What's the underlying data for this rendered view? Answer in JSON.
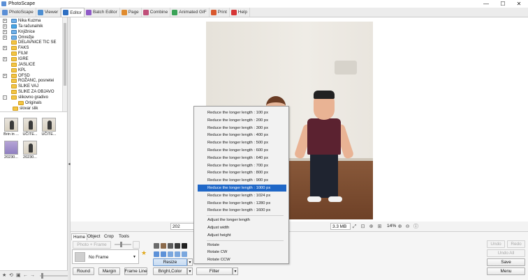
{
  "window": {
    "title": "PhotoScape",
    "minimize": "—",
    "maximize": "☐",
    "close": "✕"
  },
  "tabs": [
    {
      "label": "PhotoScape",
      "color": "#5b8fd6"
    },
    {
      "label": "Viewer",
      "color": "#4f8fd1"
    },
    {
      "label": "Editor",
      "color": "#2e6fc2"
    },
    {
      "label": "Batch Editor",
      "color": "#8f5ac7"
    },
    {
      "label": "Page",
      "color": "#e08b2e"
    },
    {
      "label": "Combine",
      "color": "#c04f79"
    },
    {
      "label": "Animated GIF",
      "color": "#3aa357"
    },
    {
      "label": "Print",
      "color": "#d9582d"
    },
    {
      "label": "Help",
      "color": "#d63535"
    }
  ],
  "folders": [
    {
      "label": "Nika Kuzma",
      "expander": "+",
      "kind": "user"
    },
    {
      "label": "Ta računalnik",
      "expander": "+",
      "kind": "blue"
    },
    {
      "label": "Knjižnice",
      "expander": "+",
      "kind": "special"
    },
    {
      "label": "Omrežje",
      "expander": "+",
      "kind": "special"
    },
    {
      "label": "DELAVNICE TIC SE",
      "expander": "",
      "kind": "folder"
    },
    {
      "label": "FAKS",
      "expander": "+",
      "kind": "folder"
    },
    {
      "label": "FILM",
      "expander": "",
      "kind": "folder"
    },
    {
      "label": "IGRE",
      "expander": "+",
      "kind": "folder"
    },
    {
      "label": "JASLICE",
      "expander": "",
      "kind": "folder"
    },
    {
      "label": "KPL",
      "expander": "",
      "kind": "folder"
    },
    {
      "label": "OFSD",
      "expander": "+",
      "kind": "folder"
    },
    {
      "label": "ROŽANC, posnetei",
      "expander": "",
      "kind": "folder"
    },
    {
      "label": "SLIKE VAJ",
      "expander": "",
      "kind": "folder"
    },
    {
      "label": "SLIKE ZA OBJAVO",
      "expander": "",
      "kind": "folder"
    },
    {
      "label": "slikovno gradivo",
      "expander": "-",
      "kind": "folder"
    },
    {
      "label": "Originals",
      "expander": "",
      "kind": "folder"
    },
    {
      "label": "slovar slik",
      "expander": "",
      "kind": "folder"
    }
  ],
  "thumbnails": [
    {
      "caption": "Brin in ...",
      "kind": "photo"
    },
    {
      "caption": "UČITE...",
      "kind": "photo"
    },
    {
      "caption": "UČITE...",
      "kind": "photo"
    },
    {
      "caption": "20230...",
      "kind": "purple"
    },
    {
      "caption": "20230...",
      "kind": "photo"
    }
  ],
  "left_toolbar_icons": [
    "★",
    "⟲",
    "▣",
    "←",
    "→"
  ],
  "status": {
    "date": "202",
    "filesize": "3.3 MB",
    "zoom": "14%"
  },
  "panel_tabs": [
    "Home",
    "Object",
    "Crop",
    "Tools"
  ],
  "panel": {
    "photo_frame": "Photo + Frame",
    "frame_value": "No Frame",
    "round": "Round",
    "margin": "Margin",
    "frame_line": "Frame Line",
    "resize": "Resize",
    "bright_color": "Bright,Color",
    "filter": "Filter",
    "undo": "Undo",
    "redo": "Redo",
    "undo_all": "Undo All",
    "save": "Save",
    "menu": "Menu",
    "arrow": "▼"
  },
  "resize_menu": {
    "items": [
      "Reduce the longer length : 100 px",
      "Reduce the longer length : 200 px",
      "Reduce the longer length : 300 px",
      "Reduce the longer length : 400 px",
      "Reduce the longer length : 500 px",
      "Reduce the longer length : 600 px",
      "Reduce the longer length : 640 px",
      "Reduce the longer length : 700 px",
      "Reduce the longer length : 800 px",
      "Reduce the longer length : 900 px",
      "Reduce the longer length : 1000 px",
      "Reduce the longer length : 1024 px",
      "Reduce the longer length : 1280 px",
      "Reduce the longer length : 1600 px"
    ],
    "adjust": [
      "Adjust the longer length",
      "Adjust width",
      "Adjust height"
    ],
    "rotate": [
      "Rotate",
      "Rotate CW",
      "Rotate CCW"
    ],
    "highlighted_index": 10
  },
  "colors": {
    "accent": "#1f67c7",
    "folder": "#f3c544"
  }
}
